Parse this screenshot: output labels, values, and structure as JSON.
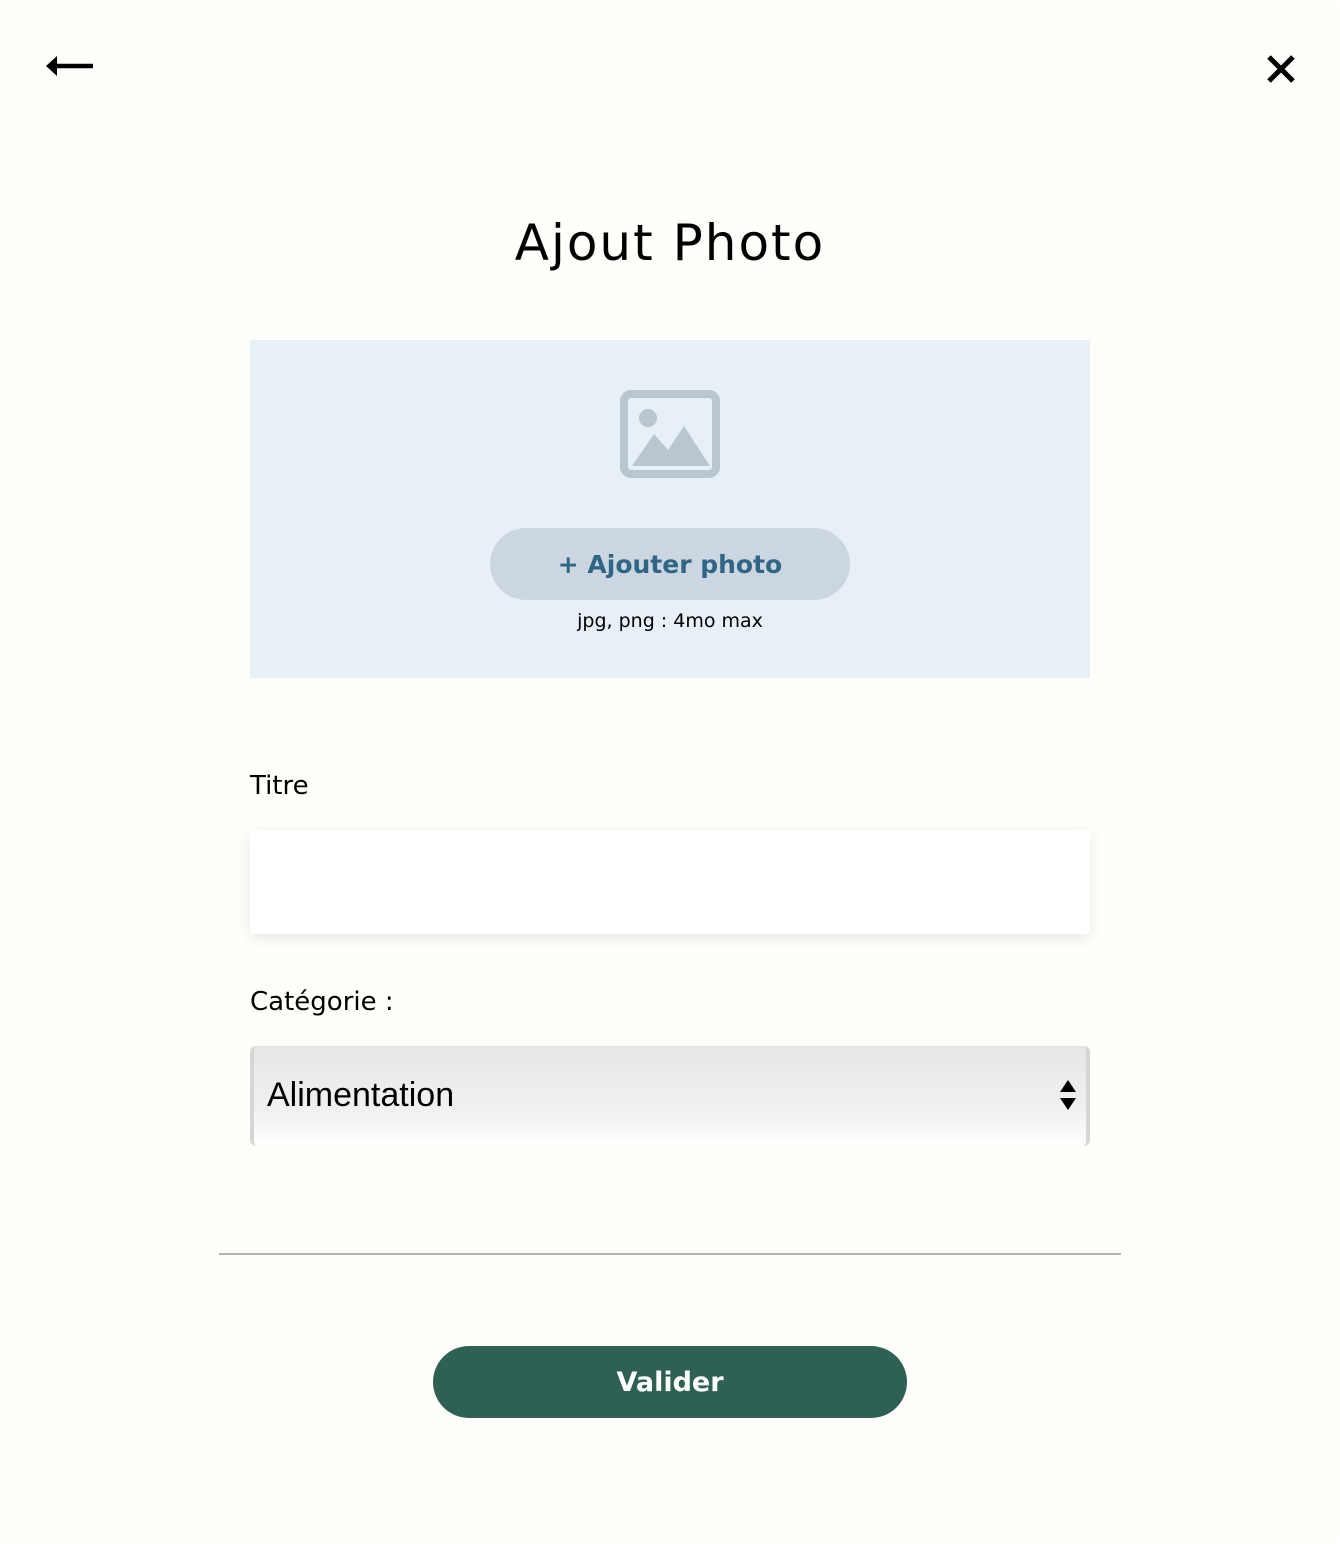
{
  "header": {
    "back_icon": "arrow-left-icon",
    "close_icon": "close-icon"
  },
  "title": "Ajout Photo",
  "upload": {
    "image_icon": "image-placeholder-icon",
    "button_label": "+ Ajouter photo",
    "hint": "jpg, png : 4mo max"
  },
  "form": {
    "title_label": "Titre",
    "title_value": "",
    "category_label": "Catégorie :",
    "category_selected": "Alimentation"
  },
  "footer": {
    "submit_label": "Valider"
  },
  "colors": {
    "background": "#fffefa",
    "upload_zone": "#e8f0f7",
    "upload_button": "#cbd6e0",
    "upload_button_text": "#306685",
    "submit_button": "#2e6153",
    "placeholder_icon": "#b9c5cf"
  }
}
